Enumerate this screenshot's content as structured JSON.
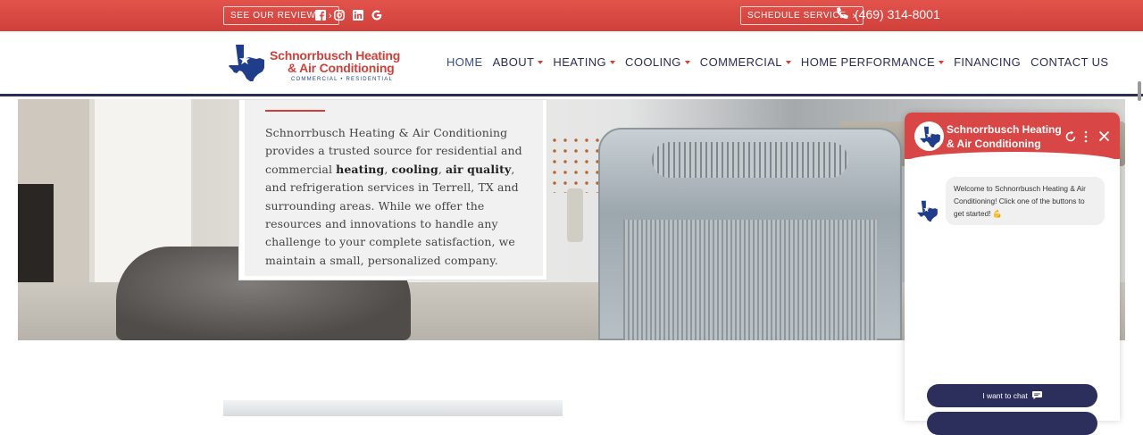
{
  "topbar": {
    "reviews_label": "SEE OUR REVIEWS",
    "schedule_label": "SCHEDULE SERVICE",
    "phone": "(469) 314-8001",
    "social_icons": [
      "facebook-icon",
      "instagram-icon",
      "linkedin-icon",
      "google-icon"
    ]
  },
  "logo": {
    "line1": "Schnorrbusch Heating",
    "line2": "& Air Conditioning",
    "line3": "COMMERCIAL • RESIDENTIAL"
  },
  "nav": {
    "items": [
      {
        "label": "HOME",
        "dropdown": false
      },
      {
        "label": "ABOUT",
        "dropdown": true
      },
      {
        "label": "HEATING",
        "dropdown": true
      },
      {
        "label": "COOLING",
        "dropdown": true
      },
      {
        "label": "COMMERCIAL",
        "dropdown": true
      },
      {
        "label": "HOME PERFORMANCE",
        "dropdown": true
      },
      {
        "label": "FINANCING",
        "dropdown": false
      },
      {
        "label": "CONTACT US",
        "dropdown": false
      }
    ]
  },
  "intro": {
    "p1": "Schnorrbusch Heating & Air Conditioning provides a trusted source for residential and commercial ",
    "b1": "heating",
    "s1": ", ",
    "b2": "cooling",
    "s2": ", ",
    "b3": "air quality",
    "p2": ", and refrigeration services in Terrell, TX and surrounding areas. While we offer the resources and innovations to handle any challenge to your complete satisfaction, we maintain a small, personalized company."
  },
  "chat": {
    "title": "Schnorrbusch Heating & Air Conditioning",
    "message": "Welcome to Schnorrbusch Heating & Air Conditioning! Click one of the buttons to get started! 💪",
    "button1": "I want to chat"
  },
  "colors": {
    "brand_red": "#d0403b",
    "navy": "#2b2d57",
    "chat_button": "#2c2e5c"
  }
}
